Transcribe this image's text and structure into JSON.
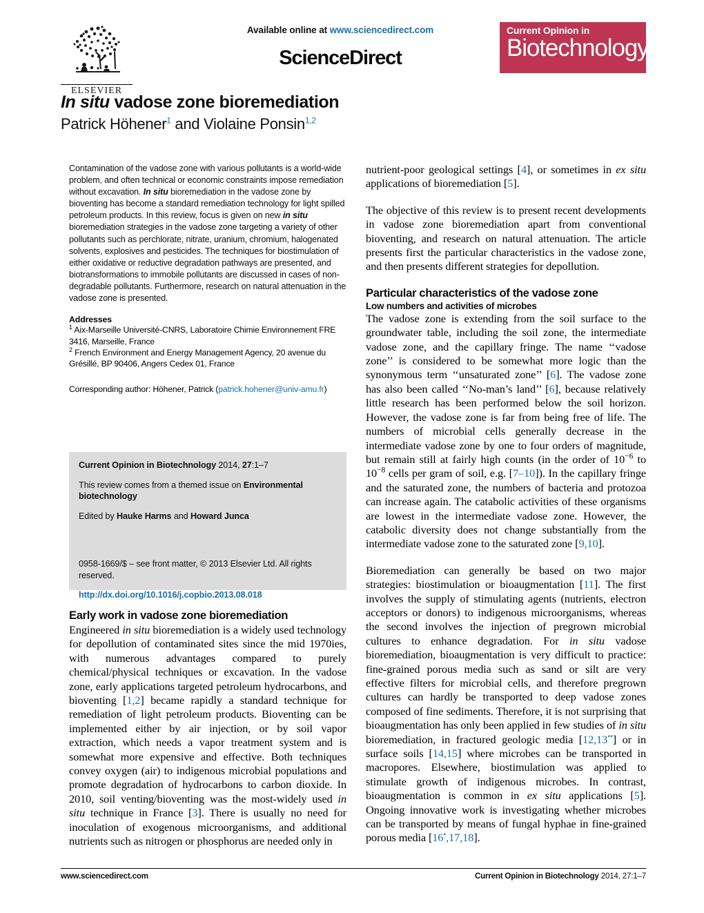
{
  "masthead": {
    "available_prefix": "Available online at ",
    "sciencedirect_url": "www.sciencedirect.com",
    "sciencedirect_logo": "ScienceDirect",
    "elsevier_wordmark": "ELSEVIER",
    "journal_banner_line1": "Current Opinion in",
    "journal_banner_line2": "Biotechnology",
    "banner_color": "#bd3552",
    "link_color": "#1a6fa8"
  },
  "title": {
    "italic_part": "In situ",
    "rest": " vadose zone bioremediation",
    "authors_plain_1": "Patrick Höhener",
    "authors_sup_1": "1",
    "authors_plain_2": " and Violaine Ponsin",
    "authors_sup_2": "1,2"
  },
  "abstract": {
    "p1_a": "Contamination of the vadose zone with various pollutants is a world-wide problem, and often technical or economic constraints impose remediation without excavation. ",
    "p1_it1": "In situ",
    "p1_b": " bioremediation in the vadose zone by bioventing has become a standard remediation technology for light spilled petroleum products. In this review, focus is given on new ",
    "p1_it2": "in situ",
    "p1_c": " bioremediation strategies in the vadose zone targeting a variety of other pollutants such as perchlorate, nitrate, uranium, chromium, halogenated solvents, explosives and pesticides. The techniques for biostimulation of either oxidative or reductive degradation pathways are presented, and biotransformations to immobile pollutants are discussed in cases of non-degradable pollutants. Furthermore, research on natural attenuation in the vadose zone is presented."
  },
  "addresses": {
    "heading": "Addresses",
    "items": [
      {
        "marker": "1",
        "text": " Aix-Marseille Université-CNRS, Laboratoire Chimie Environnement FRE 3416, Marseille, France"
      },
      {
        "marker": "2",
        "text": " French Environment and Energy Management Agency, 20 avenue du Grésillé, BP 90406, Angers Cedex 01, France"
      }
    ]
  },
  "corresponding": {
    "label": "Corresponding author: Höhener, Patrick (",
    "email": "patrick.hohener@univ-amu.fr",
    "suffix": ")"
  },
  "info_box": {
    "citation_bold": "Current Opinion in Biotechnology",
    "citation_rest_a": " 2014, ",
    "citation_vol": "27",
    "citation_rest_b": ":1–7",
    "themed_prefix": "This review comes from a themed issue on ",
    "themed_bold": "Environmental biotechnology",
    "edited_prefix": "Edited by ",
    "editor1": "Hauke Harms",
    "edited_mid": " and ",
    "editor2": "Howard Junca",
    "copyright": "0958-1669/$ – see front matter, © 2013 Elsevier Ltd. All rights reserved.",
    "doi": "http://dx.doi.org/10.1016/j.copbio.2013.08.018"
  },
  "left_section": {
    "heading": "Early work in vadose zone bioremediation",
    "p1_a": "Engineered ",
    "p1_it1": "in situ",
    "p1_b": " bioremediation is a widely used technology for depollution of contaminated sites since the mid 1970ies, with numerous advantages compared to purely chemical/physical techniques or excavation. In the vadose zone, early applications targeted petroleum hydrocarbons, and bioventing [",
    "p1_ref1": "1,2",
    "p1_c": "] became rapidly a standard technique for remediation of light petroleum products. Bioventing can be implemented either by air injection, or by soil vapor extraction, which needs a vapor treatment system and is somewhat more expensive and effective. Both techniques convey oxygen (air) to indigenous microbial populations and promote degradation of hydrocarbons to carbon dioxide. In 2010, soil venting/bioventing was the most-widely used ",
    "p1_it2": "in situ",
    "p1_d": " technique in France [",
    "p1_ref2": "3",
    "p1_e": "]. There is usually no need for inoculation of exogenous microorganisms, and additional nutrients such as nitrogen or phosphorus are needed only in"
  },
  "right_column": {
    "p0_a": "nutrient-poor geological settings [",
    "p0_ref1": "4",
    "p0_b": "], or sometimes in ",
    "p0_it1": "ex situ",
    "p0_c": " applications of bioremediation [",
    "p0_ref2": "5",
    "p0_d": "].",
    "p1": "The objective of this review is to present recent developments in vadose zone bioremediation apart from conventional bioventing, and research on natural attenuation. The article presents first the particular characteristics in the vadose zone, and then presents different strategies for depollution.",
    "section_heading": "Particular characteristics of the vadose zone",
    "subsection_heading": "Low numbers and activities of microbes",
    "p2_a": "The vadose zone is extending from the soil surface to the groundwater table, including the soil zone, the intermediate vadose zone, and the capillary fringe. The name ‘‘vadose zone’’ is considered to be somewhat more logic than the synonymous term ‘‘unsaturated zone’’ [",
    "p2_ref1": "6",
    "p2_b": "]. The vadose zone has also been called ‘‘No-man’s land’’ [",
    "p2_ref2": "6",
    "p2_c": "], because relatively little research has been performed below the soil horizon. However, the vadose zone is far from being free of life. The numbers of microbial cells generally decrease in the intermediate vadose zone by one to four orders of magnitude, but remain still at fairly high counts (in the order of 10",
    "p2_sup1": "−6",
    "p2_d": " to 10",
    "p2_sup2": "−8",
    "p2_e": " cells per gram of soil, e.g. [",
    "p2_ref3": "7–10",
    "p2_f": "]). In the capillary fringe and the saturated zone, the numbers of bacteria and protozoa can increase again. The catabolic activities of these organisms are lowest in the intermediate vadose zone. However, the catabolic diversity does not change substantially from the intermediate vadose zone to the saturated zone [",
    "p2_ref4": "9,10",
    "p2_g": "].",
    "p3_a": "Bioremediation can generally be based on two major strategies: biostimulation or bioaugmentation [",
    "p3_ref1": "11",
    "p3_b": "]. The first involves the supply of stimulating agents (nutrients, electron acceptors or donors) to indigenous microorganisms, whereas the second involves the injection of pregrown microbial cultures to enhance degradation. For ",
    "p3_it1": "in situ",
    "p3_c": " vadose bioremediation, bioaugmentation is very difficult to practice: fine-grained porous media such as sand or silt are very effective filters for microbial cells, and therefore pregrown cultures can hardly be transported to deep vadose zones composed of fine sediments. Therefore, it is not surprising that bioaugmentation has only been applied in few studies of ",
    "p3_it2": "in situ",
    "p3_d": " bioremediation, in fractured geologic media [",
    "p3_ref2": "12,13",
    "p3_ref2_sup": "••",
    "p3_e": "] or in surface soils [",
    "p3_ref3": "14,15",
    "p3_f": "] where microbes can be transported in macropores. Elsewhere, biostimulation was applied to stimulate growth of indigenous microbes. In contrast, bioaugmentation is common in ",
    "p3_it3": "ex situ",
    "p3_g": " applications [",
    "p3_ref4": "5",
    "p3_h": "]. Ongoing innovative work is investigating whether microbes can be transported by means of fungal hyphae in fine-grained porous media [",
    "p3_ref5": "16",
    "p3_ref5_sup": "•",
    "p3_i": ",",
    "p3_ref6": "17,18",
    "p3_j": "]."
  },
  "footer": {
    "left": "www.sciencedirect.com",
    "right_bold": "Current Opinion in Biotechnology",
    "right_normal": " 2014, 27:1–7"
  }
}
